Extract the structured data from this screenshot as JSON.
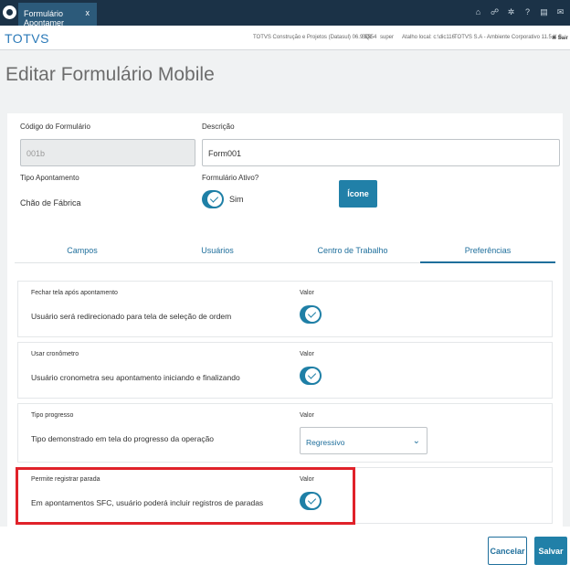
{
  "topbar": {
    "tab_label": "Formulário Apontamer",
    "tab_close": "x",
    "icons": [
      "home-icon",
      "sitemap-icon",
      "gear-icon",
      "help-icon",
      "document-icon",
      "mail-icon"
    ]
  },
  "subbar": {
    "brand": "TOTVS",
    "company": "TOTVS Construção e Projetos (Datasul) 06.9.5554",
    "db": "SQL",
    "user": "super",
    "shortcut": "Atalho local: c:\\dic116",
    "env": "TOTVS S.A - Ambiente Corporativo 11.5.X S...",
    "close_label": "Sair"
  },
  "page": {
    "title": "Editar Formulário Mobile"
  },
  "form": {
    "codigo_label": "Código do Formulário",
    "codigo_value": "001b",
    "descricao_label": "Descrição",
    "descricao_value": "Form001",
    "tipo_label": "Tipo Apontamento",
    "tipo_value": "Chão de Fábrica",
    "ativo_label": "Formulário Ativo?",
    "ativo_value": "Sim",
    "icone_button": "Ícone"
  },
  "tabs": [
    {
      "label": "Campos"
    },
    {
      "label": "Usuários"
    },
    {
      "label": "Centro de Trabalho"
    },
    {
      "label": "Preferências"
    }
  ],
  "preferences": [
    {
      "title": "Fechar tela após apontamento",
      "desc": "Usuário será redirecionado para tela de seleção de ordem",
      "valor": "Valor"
    },
    {
      "title": "Usar cronômetro",
      "desc": "Usuário cronometra seu apontamento iniciando e finalizando",
      "valor": "Valor"
    },
    {
      "title": "Tipo progresso",
      "desc": "Tipo demonstrado em tela do progresso da operação",
      "valor": "Valor",
      "select_value": "Regressivo"
    },
    {
      "title": "Permite registrar parada",
      "desc": "Em apontamentos SFC, usuário poderá incluir registros de paradas",
      "valor": "Valor"
    }
  ],
  "footer": {
    "cancel": "Cancelar",
    "save": "Salvar"
  },
  "colors": {
    "accent": "#2180a8",
    "topbar": "#1b3247",
    "highlight": "#e0222a"
  }
}
